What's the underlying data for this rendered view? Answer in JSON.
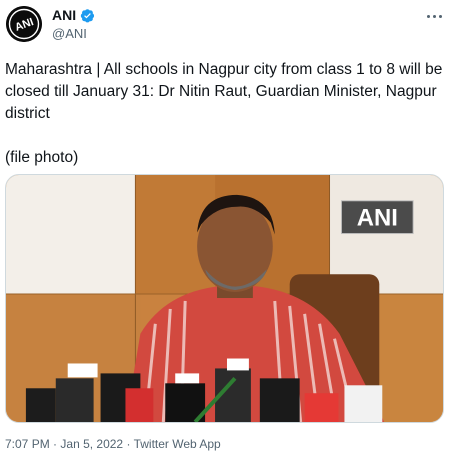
{
  "account": {
    "display_name": "ANI",
    "handle": "@ANI",
    "avatar_text": "ANI",
    "verified_icon": "verified-badge-icon"
  },
  "tweet": {
    "text": "Maharashtra | All schools in Nagpur city from class 1 to 8 will be closed till January 31: Dr Nitin Raut, Guardian Minister, Nagpur district\n\n(file photo)",
    "media_watermark": "ANI"
  },
  "meta": {
    "time": "7:07 PM",
    "date": "Jan 5, 2022",
    "source": "Twitter Web App",
    "separator": "·"
  },
  "colors": {
    "text": "#0f1419",
    "secondary": "#536471",
    "verified": "#1d9bf0",
    "border": "#cfd9de"
  }
}
